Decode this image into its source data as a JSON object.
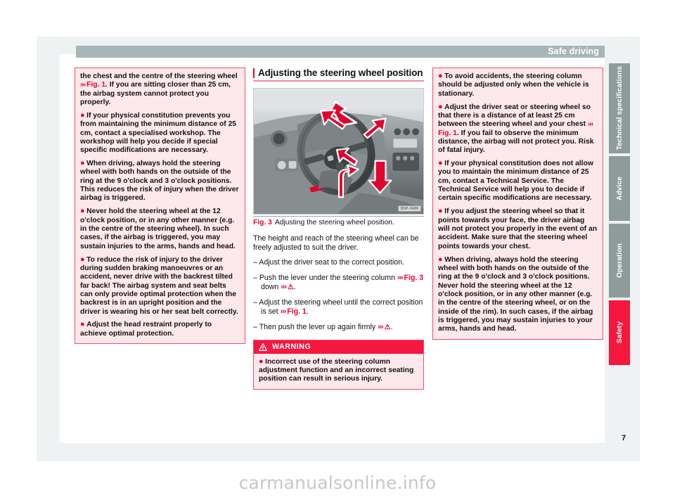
{
  "header": {
    "running_title": "Safe driving"
  },
  "page_number": "7",
  "watermark": "carmanualsonline.info",
  "left_column": {
    "warning_box": {
      "paragraphs": [
        {
          "bullet": false,
          "runs": [
            {
              "t": "the chest and the centre of the steering wheel "
            },
            {
              "t": "››› ",
              "style": "chev"
            },
            {
              "t": "Fig. 1",
              "style": "figref"
            },
            {
              "t": ". If you are sitting closer than 25 cm, the airbag system cannot protect you properly."
            }
          ]
        },
        {
          "bullet": true,
          "runs": [
            {
              "t": "If your physical constitution prevents you from maintaining the minimum distance of 25 cm, contact a specialised workshop. The workshop will help you decide if special specific modifications are necessary."
            }
          ]
        },
        {
          "bullet": true,
          "runs": [
            {
              "t": "When driving, always hold the steering wheel with both hands on the outside of the ring at the 9 o'clock and 3 o'clock positions. This reduces the risk of injury when the driver airbag is triggered."
            }
          ]
        },
        {
          "bullet": true,
          "runs": [
            {
              "t": "Never hold the steering wheel at the 12 o'clock position, or in any other manner (e.g. in the centre of the steering wheel). In such cases, if the airbag is triggered, you may sustain injuries to the arms, hands and head."
            }
          ]
        },
        {
          "bullet": true,
          "runs": [
            {
              "t": "To reduce the risk of injury to the driver during sudden braking manoeuvres or an accident, never drive with the backrest tilted far back! The airbag system and seat belts can only provide optimal protection when the backrest is in an upright position and the driver is wearing his or her seat belt correctly."
            }
          ]
        },
        {
          "bullet": true,
          "runs": [
            {
              "t": "Adjust the head restraint properly to achieve optimal protection."
            }
          ]
        }
      ]
    }
  },
  "middle_column": {
    "section_heading": "Adjusting the steering wheel position",
    "figure": {
      "image_code": "B5P-0489",
      "caption_label": "Fig. 3",
      "caption_text": "Adjusting the steering wheel position.",
      "alt": "Car dashboard with steering wheel and red arrows showing height and reach adjustment directions"
    },
    "body": [
      {
        "type": "para",
        "runs": [
          {
            "t": "The height and reach of the steering wheel can be freely adjusted to suit the driver."
          }
        ]
      },
      {
        "type": "step",
        "runs": [
          {
            "t": "– Adjust the driver seat to the correct position."
          }
        ]
      },
      {
        "type": "step",
        "runs": [
          {
            "t": "– Push the lever under the steering column "
          },
          {
            "t": "››› ",
            "style": "chev"
          },
          {
            "t": "Fig. 3",
            "style": "figref"
          },
          {
            "t": " down "
          },
          {
            "t": "››› ",
            "style": "chev"
          },
          {
            "t": "⚠",
            "style": "tri"
          },
          {
            "t": "."
          }
        ]
      },
      {
        "type": "step",
        "runs": [
          {
            "t": "– Adjust the steering wheel until the correct position is set "
          },
          {
            "t": "››› ",
            "style": "chev"
          },
          {
            "t": "Fig. 1",
            "style": "figref"
          },
          {
            "t": "."
          }
        ]
      },
      {
        "type": "step",
        "runs": [
          {
            "t": "– Then push the lever up again firmly "
          },
          {
            "t": "››› ",
            "style": "chev"
          },
          {
            "t": "⚠",
            "style": "tri"
          },
          {
            "t": "."
          }
        ]
      }
    ],
    "warning": {
      "title": "WARNING",
      "text": "Incorrect use of the steering column adjustment function and an incorrect seating position can result in serious injury."
    }
  },
  "right_column": {
    "warning_box": {
      "paragraphs": [
        {
          "bullet": true,
          "runs": [
            {
              "t": "To avoid accidents, the steering column should be adjusted only when the vehicle is stationary."
            }
          ]
        },
        {
          "bullet": true,
          "runs": [
            {
              "t": "Adjust the driver seat or steering wheel so that there is a distance of at least 25 cm between the steering wheel and your chest "
            },
            {
              "t": "››› ",
              "style": "chev"
            },
            {
              "t": "Fig. 1",
              "style": "figref"
            },
            {
              "t": ". If you fail to observe the minimum distance, the airbag will not protect you. Risk of fatal injury."
            }
          ]
        },
        {
          "bullet": true,
          "runs": [
            {
              "t": "If your physical constitution does not allow you to maintain the minimum distance of 25 cm, contact a Technical Service. The Technical Service will help you to decide if certain specific modifications are necessary."
            }
          ]
        },
        {
          "bullet": true,
          "runs": [
            {
              "t": "If you adjust the steering wheel so that it points towards your face, the driver airbag will not protect you properly in the event of an accident. Make sure that the steering wheel points towards your chest."
            }
          ]
        },
        {
          "bullet": true,
          "runs": [
            {
              "t": "When driving, always hold the steering wheel with both hands on the outside of the ring at the 9 o'clock and 3 o'clock positions. Never hold the steering wheel at the 12 o'clock position, or in any other manner (e.g. in the centre of the steering wheel, or on the inside of the rim). In such cases, if the airbag is triggered, you may sustain injuries to your arms, hands and head."
            }
          ]
        }
      ]
    }
  },
  "side_tabs": [
    {
      "label": "Technical specifications",
      "active": false
    },
    {
      "label": "Advice",
      "active": false
    },
    {
      "label": "Operation",
      "active": false
    },
    {
      "label": "Safety",
      "active": true
    }
  ],
  "colors": {
    "accent_red": "#e3032e",
    "warning_red": "#f5173e",
    "warning_bg": "#fde8ec",
    "warning_border": "#e8506e",
    "header_band": "#a8b5b6",
    "tab_inactive": "#8d9b9b",
    "mat": "#eff2f3"
  }
}
